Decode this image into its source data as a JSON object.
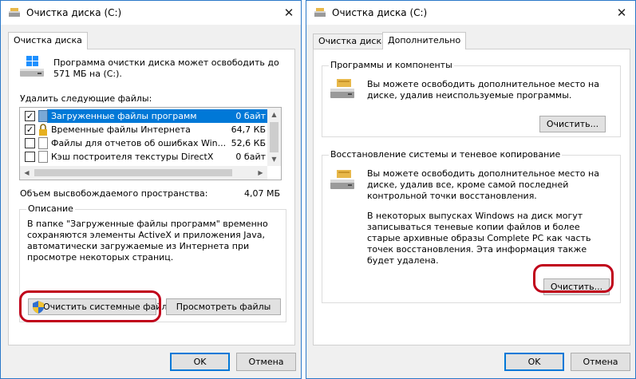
{
  "left_window": {
    "title": "Очистка диска  (C:)",
    "close_glyph": "✕",
    "tab": "Очистка диска",
    "intro": "Программа очистки диска может освободить до 571 МБ на  (C:).",
    "files_label": "Удалить следующие файлы:",
    "files": [
      {
        "name": "Загруженные файлы программ",
        "size": "0 байт",
        "checked": true,
        "selected": true
      },
      {
        "name": "Временные файлы Интернета",
        "size": "64,7 КБ",
        "checked": true,
        "selected": false
      },
      {
        "name": "Файлы для отчетов об ошибках Win...",
        "size": "52,6 КБ",
        "checked": false,
        "selected": false
      },
      {
        "name": "Кэш построителя текстуры DirectX",
        "size": "0 байт",
        "checked": false,
        "selected": false
      }
    ],
    "space_label": "Объем высвобождаемого пространства:",
    "space_value": "4,07 МБ",
    "description_title": "Описание",
    "description_text": "В папке \"Загруженные файлы программ\" временно сохраняются элементы ActiveX и приложения Java, автоматически загружаемые из Интернета при просмотре некоторых страниц.",
    "btn_system": "Очистить системные файлы",
    "btn_view": "Просмотреть файлы",
    "btn_ok": "OK",
    "btn_cancel": "Отмена"
  },
  "right_window": {
    "title": "Очистка диска  (C:)",
    "close_glyph": "✕",
    "tab_cleanup": "Очистка диска",
    "tab_more": "Дополнительно",
    "programs_title": "Программы и компоненты",
    "programs_text": "Вы можете освободить дополнительное место на диске, удалив неиспользуемые программы.",
    "programs_btn": "Очистить...",
    "restore_title": "Восстановление системы и теневое копирование",
    "restore_text1": "Вы можете освободить дополнительное место на диске, удалив все, кроме самой последней контрольной точки восстановления.",
    "restore_text2": "В некоторых выпусках Windows на диск могут записываться теневые копии файлов и более старые архивные образы Complete PC как часть точек восстановления. Эта информация также будет удалена.",
    "restore_btn": "Очистить...",
    "btn_ok": "OK",
    "btn_cancel": "Отмена"
  },
  "colors": {
    "highlight": "#0078d7",
    "annotation_red": "#c0001a",
    "window_border": "#2a78c8"
  },
  "icons": {
    "title": "disk-cleanup-icon",
    "drive": "windows-drive-icon",
    "shield": "uac-shield-icon",
    "programs": "programs-drive-icon",
    "restore": "restore-drive-icon"
  }
}
